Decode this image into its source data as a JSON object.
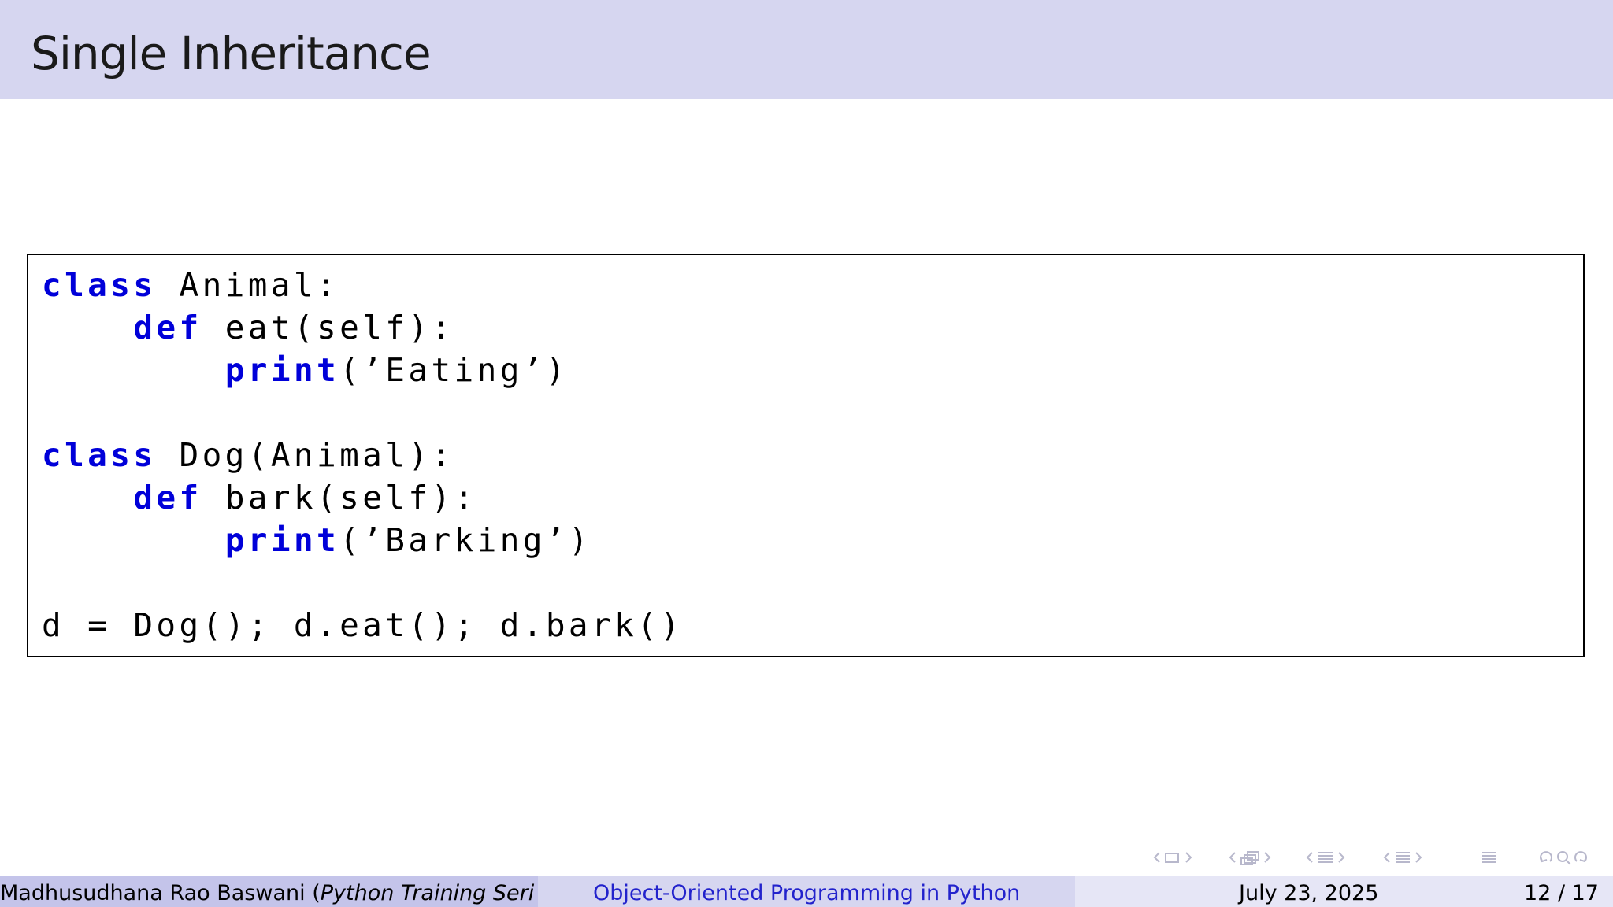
{
  "slide": {
    "title": "Single Inheritance"
  },
  "code": {
    "line1_kw": "class",
    "line1_rest": " Animal:",
    "line2_indent": "    ",
    "line2_kw": "def",
    "line2_rest": " eat(self):",
    "line3_indent": "        ",
    "line3_kw": "print",
    "line3_rest": "(’Eating’)",
    "line5_kw": "class",
    "line5_rest": " Dog(Animal):",
    "line6_indent": "    ",
    "line6_kw": "def",
    "line6_rest": " bark(self):",
    "line7_indent": "        ",
    "line7_kw": "print",
    "line7_rest": "(’Barking’)",
    "line9": "d = Dog(); d.eat(); d.bark()"
  },
  "nav": {
    "icon_names": [
      "nav-prev-frame-icon",
      "nav-frame-icon",
      "nav-next-frame-icon",
      "nav-section-icon",
      "nav-subsection-icon",
      "nav-menu-icon",
      "nav-search-icon",
      "nav-undo-icon"
    ]
  },
  "footer": {
    "author": "Madhusudhana Rao Baswani (",
    "author_italic": "Python Training Seri",
    "talk_title": "Object-Oriented Programming in Python",
    "date": "July 23, 2025",
    "page": "12 / 17"
  },
  "colors": {
    "keyword": "#0000d9",
    "title_bar": "#d6d6f0",
    "footer_title_text": "#2222cc"
  }
}
